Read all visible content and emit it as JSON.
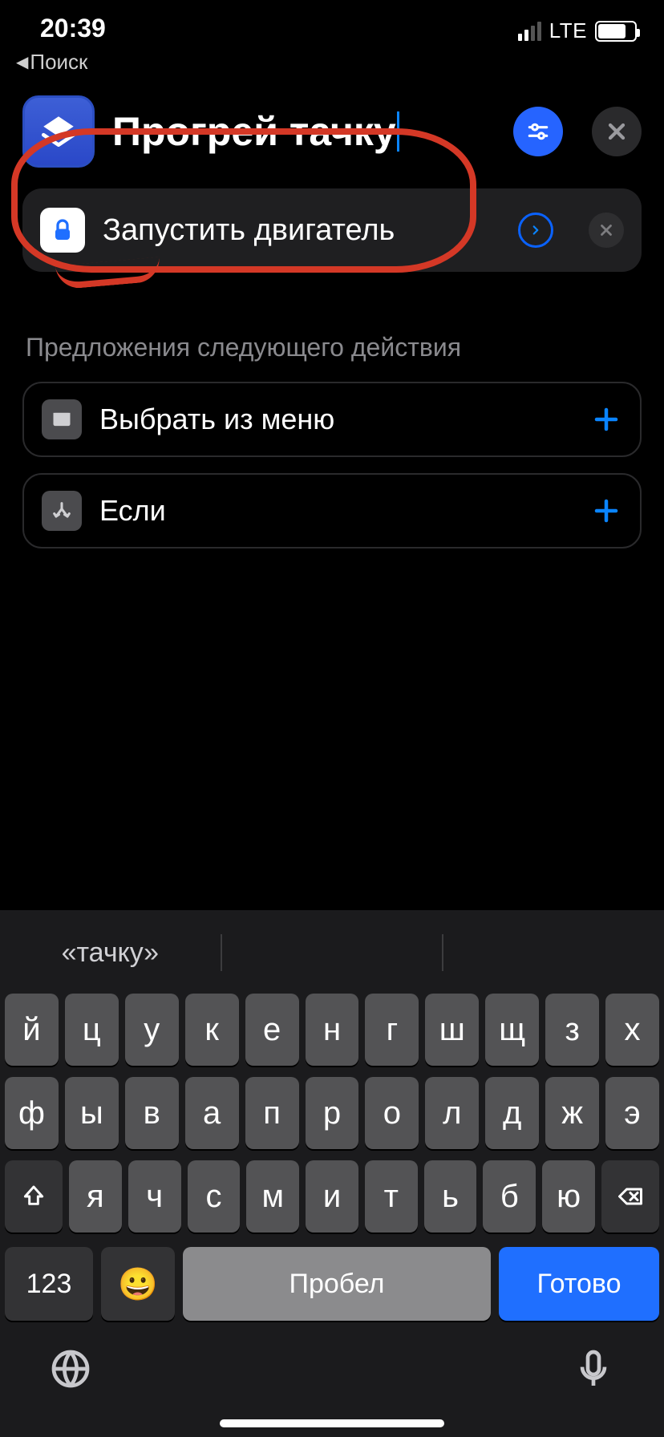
{
  "status": {
    "time": "20:39",
    "network": "LTE"
  },
  "back": {
    "label": "Поиск"
  },
  "header": {
    "title": "Прогрей тачку"
  },
  "action": {
    "label": "Запустить двигатель"
  },
  "suggestions": {
    "title": "Предложения следующего действия",
    "items": [
      {
        "label": "Выбрать из меню"
      },
      {
        "label": "Если"
      }
    ]
  },
  "keyboard": {
    "suggestion": "«тачку»",
    "row1": [
      "й",
      "ц",
      "у",
      "к",
      "е",
      "н",
      "г",
      "ш",
      "щ",
      "з",
      "х"
    ],
    "row2": [
      "ф",
      "ы",
      "в",
      "а",
      "п",
      "р",
      "о",
      "л",
      "д",
      "ж",
      "э"
    ],
    "row3": [
      "я",
      "ч",
      "с",
      "м",
      "и",
      "т",
      "ь",
      "б",
      "ю"
    ],
    "numKey": "123",
    "space": "Пробел",
    "done": "Готово"
  }
}
